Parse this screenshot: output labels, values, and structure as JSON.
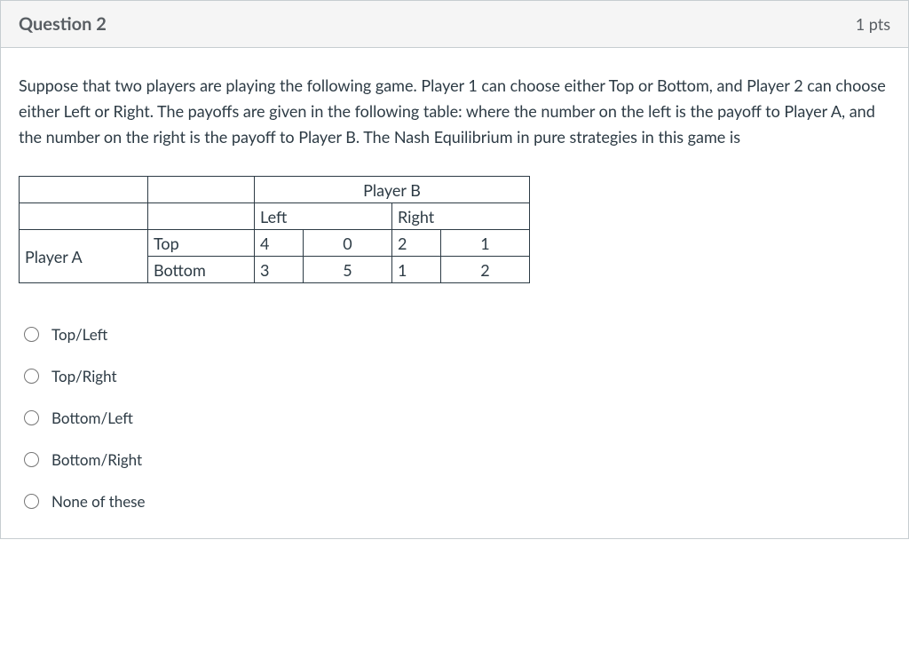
{
  "header": {
    "title": "Question 2",
    "points": "1 pts"
  },
  "prompt": "Suppose that two players are playing the following game. Player 1 can choose either Top or Bottom, and Player 2 can choose either Left or Right. The payoffs are given in the following table: where the number on the left is the payoff to Player A, and the number on the right is the payoff to Player B. The Nash Equilibrium in pure strategies in this game is",
  "table": {
    "playerB": "Player B",
    "playerA": "Player A",
    "colLeft": "Left",
    "colRight": "Right",
    "rowTop": "Top",
    "rowBottom": "Bottom",
    "cells": {
      "top_left_a": "4",
      "top_left_b": "0",
      "top_right_a": "2",
      "top_right_b": "1",
      "bottom_left_a": "3",
      "bottom_left_b": "5",
      "bottom_right_a": "1",
      "bottom_right_b": "2"
    }
  },
  "options": [
    "Top/Left",
    "Top/Right",
    "Bottom/Left",
    "Bottom/Right",
    "None of these"
  ]
}
